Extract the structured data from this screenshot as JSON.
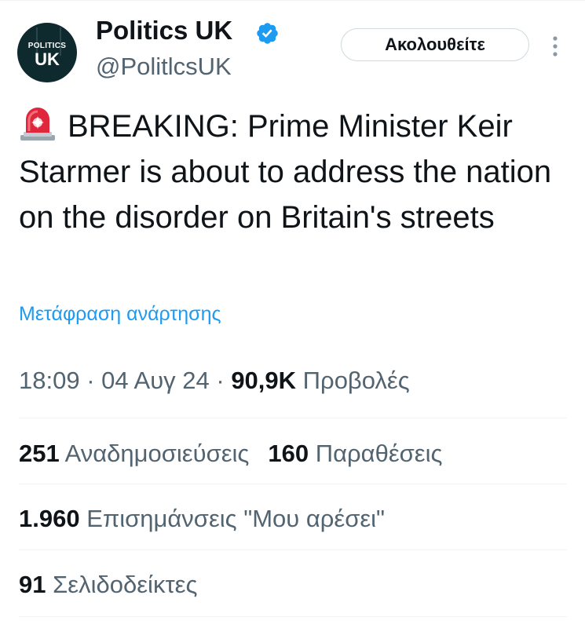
{
  "account": {
    "avatar_line1": "POLITICS",
    "avatar_line2": "UK",
    "display_name": "Politics UK",
    "handle": "@PolitlcsUK",
    "verified": true,
    "follow_label": "Ακολουθείτε"
  },
  "tweet": {
    "icon": "police-siren-emoji",
    "text": "BREAKING: Prime Minister Keir Starmer is about to address the nation on the disorder on Britain's streets",
    "translate_label": "Μετάφραση ανάρτησης"
  },
  "meta": {
    "time": "18:09",
    "sep1": " · ",
    "date": "04 Αυγ 24",
    "sep2": " · ",
    "views_count": "90,9K",
    "views_label": "Προβολές"
  },
  "stats": {
    "reposts_count": "251",
    "reposts_label": "Αναδημοσιεύσεις",
    "quotes_count": "160",
    "quotes_label": "Παραθέσεις",
    "likes_count": "1.960",
    "likes_label": "Επισημάνσεις \"Μου αρέσει\"",
    "bookmarks_count": "91",
    "bookmarks_label": "Σελιδοδείκτες"
  },
  "colors": {
    "accent": "#1d9bf0",
    "text_primary": "#0f1419",
    "text_secondary": "#536471",
    "divider": "#eff3f4",
    "avatar_bg": "#0f2a2f"
  }
}
